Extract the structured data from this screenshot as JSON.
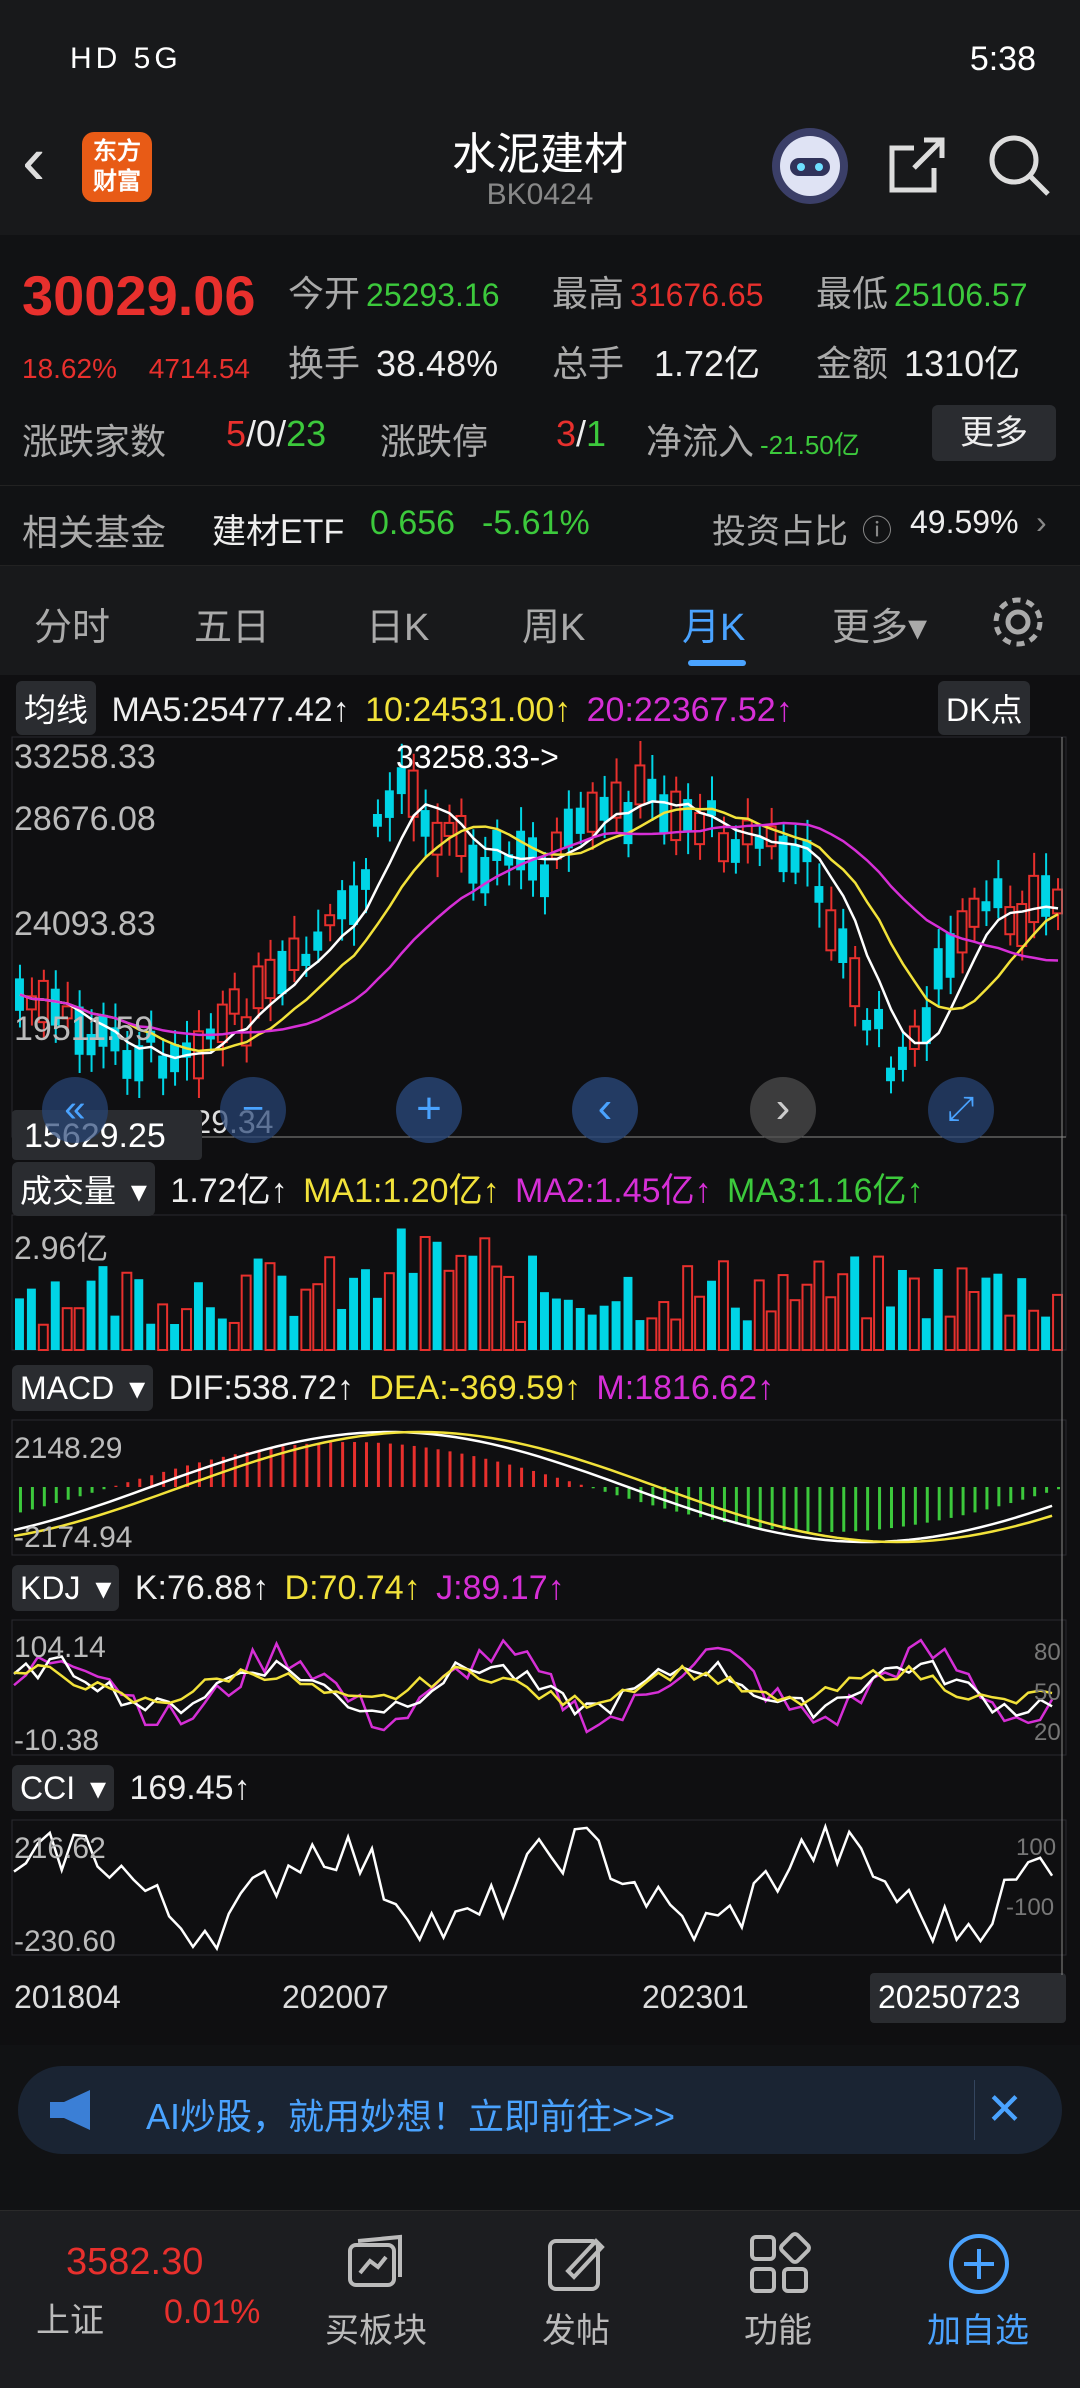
{
  "status": {
    "time": "5:38",
    "left_icons": "HD 5G",
    "dots": "···"
  },
  "header": {
    "title": "水泥建材",
    "code": "BK0424",
    "logo_text": "东方财富",
    "back": "‹"
  },
  "quote": {
    "price": "30029.06",
    "change_pct": "18.62%",
    "change_abs": "4714.54",
    "open_label": "今开",
    "open": "25293.16",
    "high_label": "最高",
    "high": "31676.65",
    "low_label": "最低",
    "low": "25106.57",
    "turnover_label": "换手",
    "turnover": "38.48%",
    "volume_label": "总手",
    "volume": "1.72亿",
    "amount_label": "金额",
    "amount": "1310亿",
    "updown_label": "涨跌家数",
    "up": "5",
    "flat": "0",
    "down": "23",
    "limit_label": "涨跌停",
    "limit_up": "3",
    "limit_down": "1",
    "inflow_label": "净流入",
    "inflow": "-21.50亿",
    "more_label": "更多",
    "fund_label": "相关基金",
    "fund_name": "建材ETF",
    "fund_price": "0.656",
    "fund_chg": "-5.61%",
    "ratio_label": "投资占比",
    "ratio": "49.59%"
  },
  "tabs": [
    {
      "label": "分时"
    },
    {
      "label": "五日"
    },
    {
      "label": "日K"
    },
    {
      "label": "周K"
    },
    {
      "label": "月K"
    },
    {
      "label": "更多▾"
    }
  ],
  "ma": {
    "sel": "均线",
    "ma5": "MA5:25477.42↑",
    "ma10": "10:24531.00↑",
    "ma20": "20:22367.52↑",
    "dk": "DK点"
  },
  "price_axis": {
    "p1": "33258.33",
    "p2": "28676.08",
    "p3": "24093.83",
    "p4": "19511.59",
    "p5": "15629.25",
    "low": "14929.34",
    "marker": "33258.33->"
  },
  "vol": {
    "sel": "成交量",
    "v": "1.72亿↑",
    "ma1": "MA1:1.20亿↑",
    "ma2": "MA2:1.45亿↑",
    "ma3": "MA3:1.16亿↑",
    "axis": "2.96亿"
  },
  "macd": {
    "sel": "MACD",
    "dif": "DIF:538.72↑",
    "dea": "DEA:-369.59↑",
    "m": "M:1816.62↑",
    "top": "2148.29",
    "bot": "-2174.94"
  },
  "kdj": {
    "sel": "KDJ",
    "k": "K:76.88↑",
    "d": "D:70.74↑",
    "j": "J:89.17↑",
    "top": "104.14",
    "bot": "-10.38",
    "r80": "80",
    "r50": "50",
    "r20": "20"
  },
  "cci": {
    "sel": "CCI",
    "v": "169.45↑",
    "top": "216.62",
    "bot": "-230.60",
    "r100": "100",
    "rm100": "-100"
  },
  "dates": {
    "d1": "201804",
    "d2": "202007",
    "d3": "202301",
    "d4": "20250723"
  },
  "ai": {
    "text": "AI炒股，就用妙想！立即前往>>>"
  },
  "bottom": {
    "index_value": "3582.30",
    "index_name": "上证",
    "index_chg": "0.01%",
    "items": [
      {
        "label": "买板块"
      },
      {
        "label": "发帖"
      },
      {
        "label": "功能"
      },
      {
        "label": "加自选"
      }
    ]
  },
  "colors": {
    "up": "#e8302d",
    "down": "#00d5e6",
    "accent": "#4aa3ff",
    "ma5": "#ffffff",
    "ma10": "#f2e23a",
    "ma20": "#d62fd6"
  }
}
